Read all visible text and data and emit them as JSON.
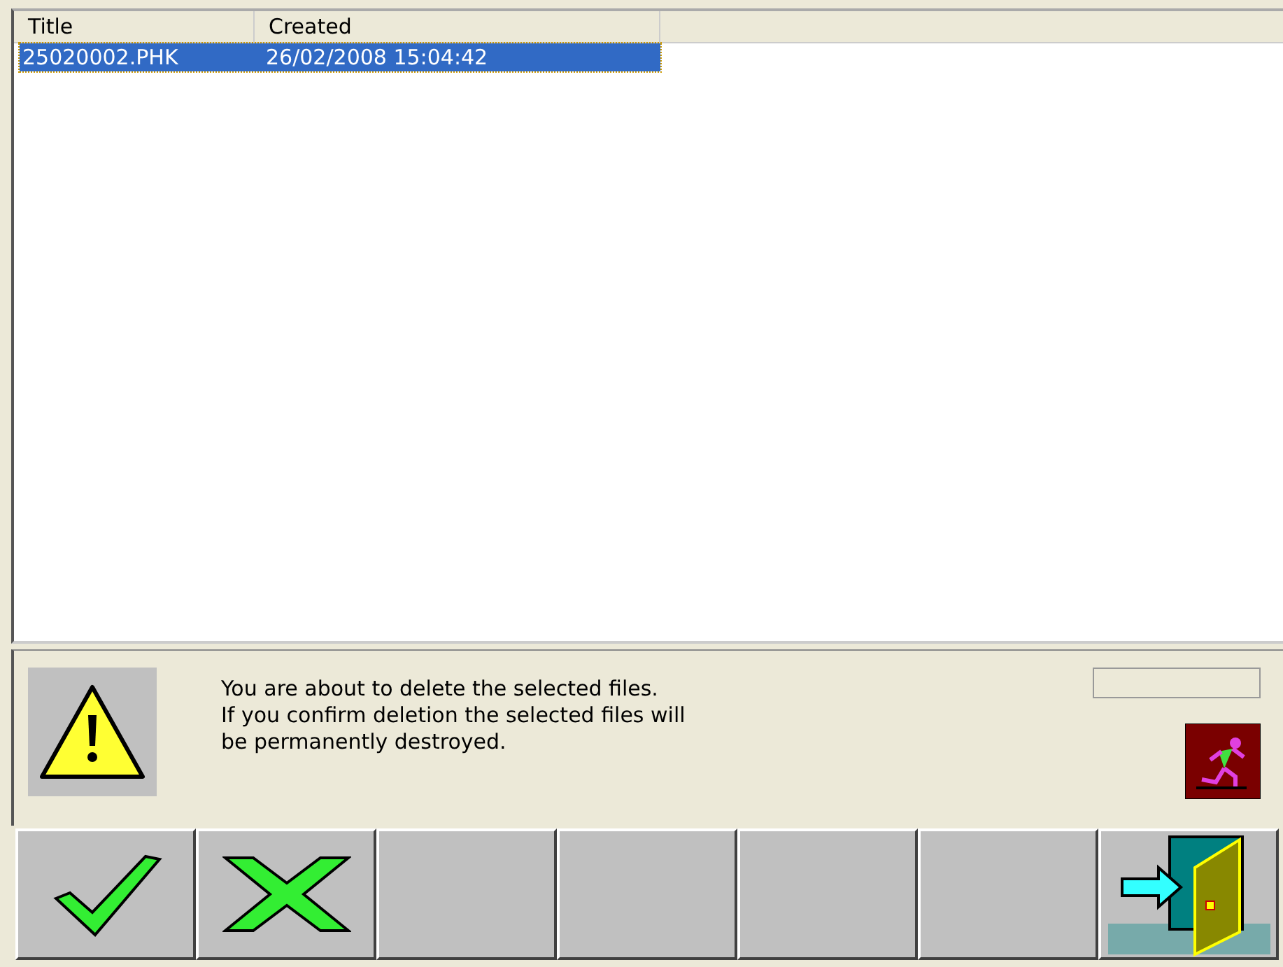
{
  "table": {
    "columns": [
      "Title",
      "Created"
    ],
    "rows": [
      {
        "cells": [
          "25020002.PHK",
          "26/02/2008 15:04:42"
        ],
        "selected": true
      }
    ]
  },
  "progress": {
    "level": 0
  },
  "message": {
    "lines": [
      "You are about to delete the selected files.",
      "If you confirm deletion the selected files will",
      "be permanently destroyed."
    ]
  },
  "buttons": [
    {
      "kind": "confirm"
    },
    {
      "kind": "cancel"
    },
    {
      "kind": "blank"
    },
    {
      "kind": "blank"
    },
    {
      "kind": "blank"
    },
    {
      "kind": "blank"
    },
    {
      "kind": "exit"
    }
  ]
}
